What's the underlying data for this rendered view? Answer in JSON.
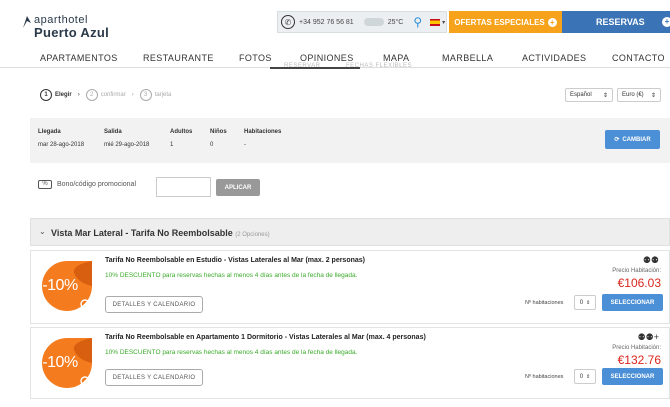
{
  "header": {
    "logo_line1": "aparthotel",
    "logo_line2": "Puerto Azul",
    "phone": "+34 952 76 56 81",
    "temperature": "25°C",
    "ofertas_label": "OFERTAS ESPECIALES",
    "reservas_label": "RESERVAS",
    "icons": [
      "phone-icon",
      "cloud-icon",
      "location-pin-icon",
      "spain-flag-icon",
      "plus-icon"
    ]
  },
  "nav": {
    "items": [
      "APARTAMENTOS",
      "RESTAURANTE",
      "FOTOS",
      "OPINIONES",
      "MAPA",
      "MARBELLA",
      "ACTIVIDADES",
      "CONTACTO"
    ],
    "subtabs": [
      "RESERVAR",
      "FECHAS FLEXIBLES"
    ]
  },
  "steps": {
    "items": [
      {
        "num": "1",
        "label": "Elegir"
      },
      {
        "num": "2",
        "label": "confirmar"
      },
      {
        "num": "3",
        "label": "tarjeta"
      }
    ],
    "language": "Español",
    "currency": "Euro (€)"
  },
  "summary": {
    "llegada_label": "Llegada",
    "llegada_value": "mar 28-ago-2018",
    "salida_label": "Salida",
    "salida_value": "mié 29-ago-2018",
    "adultos_label": "Adultos",
    "adultos_value": "1",
    "ninos_label": "Niños",
    "ninos_value": "0",
    "habitaciones_label": "Habitaciones",
    "habitaciones_value": "-",
    "cambiar_label": "CAMBIAR"
  },
  "promo": {
    "label": "Bono/código promocional",
    "value": "",
    "button": "APLICAR"
  },
  "group": {
    "title": "Vista Mar Lateral - Tarifa No Reembolsable",
    "count": "(2 Opciones)"
  },
  "rooms": [
    {
      "badge": "-10%",
      "title": "Tarifa No Reembolsable en Estudio - Vistas Laterales al Mar (max. 2 personas)",
      "discount": "10% DESCUENTO para reservas hechas al menos 4 días antes de la fecha de llegada.",
      "details_button": "DETALLES Y CALENDARIO",
      "pax": "👤👤",
      "price_label": "Precio Habitación:",
      "price": "€106.03",
      "rooms_label": "Nº habitaciones",
      "qty": "0",
      "select_button": "SELECCIONAR"
    },
    {
      "badge": "-10%",
      "title": "Tarifa No Reembolsable en Apartamento 1 Dormitorio - Vistas Laterales al Mar (max. 4 personas)",
      "discount": "10% DESCUENTO para reservas hechas al menos 4 días antes de la fecha de llegada.",
      "details_button": "DETALLES Y CALENDARIO",
      "pax": "👤👤+",
      "price_label": "Precio Habitación:",
      "price": "€132.76",
      "rooms_label": "Nº habitaciones",
      "qty": "0",
      "select_button": "SELECCIONAR"
    }
  ],
  "colors": {
    "orange": "#f7a21b",
    "blue": "#3a73b6",
    "button_blue": "#4b8fd6",
    "price_red": "#d9261c",
    "discount_green": "#3aaa2a"
  }
}
